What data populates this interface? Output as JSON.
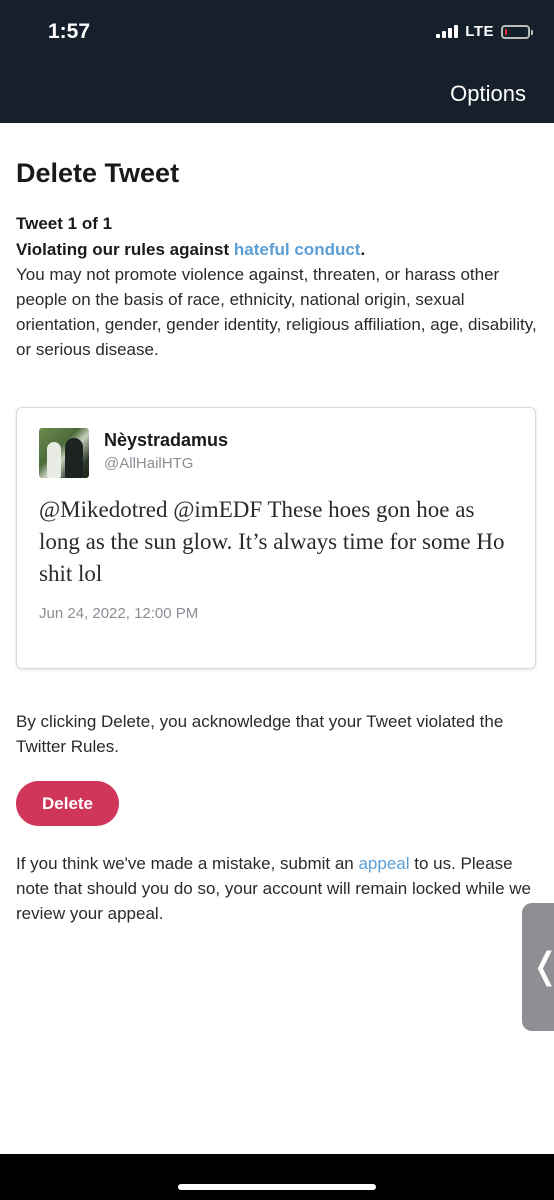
{
  "status_bar": {
    "time": "1:57",
    "network": "LTE",
    "battery_level": 0.1,
    "battery_color": "#e5342c"
  },
  "header": {
    "options_label": "Options",
    "background": "#16202c"
  },
  "page": {
    "title": "Delete Tweet",
    "tweet_count": "Tweet 1 of 1",
    "violation_prefix": "Violating our rules against ",
    "violation_link": "hateful conduct",
    "violation_suffix": ".",
    "rule_description": "You may not promote violence against, threaten, or harass other people on the basis of race, ethnicity, national origin, sexual orientation, gender, gender identity, religious affiliation, age, disability, or serious disease."
  },
  "tweet": {
    "display_name": "Nèystradamus",
    "handle": "@AllHailHTG",
    "text": "@Mikedotred @imEDF These hoes gon hoe as long as the sun glow. It’s always time for some Ho shit lol",
    "date": "Jun 24, 2022, 12:00 PM"
  },
  "acknowledge_text": "By clicking Delete, you acknowledge that your Tweet violated the Twitter Rules.",
  "delete_button_label": "Delete",
  "appeal": {
    "prefix": "If you think we've made a mistake, submit an ",
    "link": "appeal",
    "suffix": " to us. Please note that should you do so, your account will remain locked while we review your appeal."
  },
  "side_tab_icon": "❬",
  "colors": {
    "accent_link": "#5b9fd6",
    "delete_button": "#d0365a"
  }
}
